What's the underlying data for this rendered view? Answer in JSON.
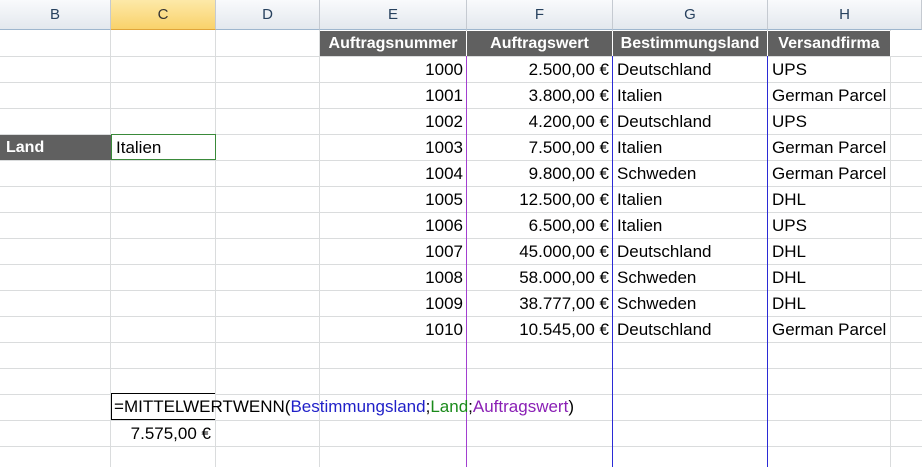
{
  "columns": [
    {
      "letter": "B"
    },
    {
      "letter": "C"
    },
    {
      "letter": "D"
    },
    {
      "letter": "E"
    },
    {
      "letter": "F"
    },
    {
      "letter": "G"
    },
    {
      "letter": "H"
    }
  ],
  "table": {
    "headers": [
      "Auftragsnummer",
      "Auftragswert",
      "Bestimmungsland",
      "Versandfirma"
    ],
    "rows": [
      [
        "1000",
        "2.500,00 €",
        "Deutschland",
        "UPS"
      ],
      [
        "1001",
        "3.800,00 €",
        "Italien",
        "German Parcel"
      ],
      [
        "1002",
        "4.200,00 €",
        "Deutschland",
        "UPS"
      ],
      [
        "1003",
        "7.500,00 €",
        "Italien",
        "German Parcel"
      ],
      [
        "1004",
        "9.800,00 €",
        "Schweden",
        "German Parcel"
      ],
      [
        "1005",
        "12.500,00 €",
        "Italien",
        "DHL"
      ],
      [
        "1006",
        "6.500,00 €",
        "Italien",
        "UPS"
      ],
      [
        "1007",
        "45.000,00 €",
        "Deutschland",
        "DHL"
      ],
      [
        "1008",
        "58.000,00 €",
        "Schweden",
        "DHL"
      ],
      [
        "1009",
        "38.777,00 €",
        "Schweden",
        "DHL"
      ],
      [
        "1010",
        "10.545,00 €",
        "Deutschland",
        "German Parcel"
      ]
    ]
  },
  "criteria": {
    "label": "Land",
    "value": "Italien"
  },
  "formula": {
    "eq": "=",
    "func": "MITTELWERTWENN(",
    "arg1": "Bestimmungsland",
    "sep1": ";",
    "arg2": "Land",
    "sep2": ";",
    "arg3": "Auftragswert",
    "close": ")"
  },
  "result": "7.575,00 €",
  "colors": {
    "arg1": "#1f1fc8",
    "arg2": "#1a8a1a",
    "arg3": "#8a1fb5",
    "header_bg": "#606060",
    "selected_col": "#f9d26b"
  }
}
